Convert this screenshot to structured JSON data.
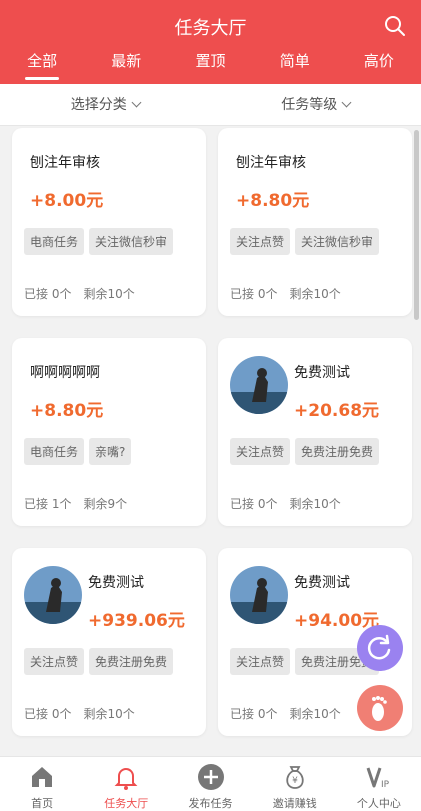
{
  "header": {
    "title": "任务大厅",
    "tabs": [
      "全部",
      "最新",
      "置顶",
      "简单",
      "高价"
    ]
  },
  "filters": {
    "category": "选择分类",
    "level": "任务等级"
  },
  "cards": [
    {
      "name": "刨注年审核",
      "price": "+8.00元",
      "tags": [
        "电商任务",
        "关注微信秒审"
      ],
      "taken": "已接 0个",
      "left": "剩余10个",
      "avatar": false
    },
    {
      "name": "刨注年审核",
      "price": "+8.80元",
      "tags": [
        "关注点赞",
        "关注微信秒审"
      ],
      "taken": "已接 0个",
      "left": "剩余10个",
      "avatar": false
    },
    {
      "name": "啊啊啊啊啊",
      "price": "+8.80元",
      "tags": [
        "电商任务",
        "亲嘴?"
      ],
      "taken": "已接 1个",
      "left": "剩余9个",
      "avatar": false
    },
    {
      "name": "免费测试",
      "price": "+20.68元",
      "tags": [
        "关注点赞",
        "免费注册免费"
      ],
      "taken": "已接 0个",
      "left": "剩余10个",
      "avatar": true
    },
    {
      "name": "免费测试",
      "price": "+939.06元",
      "tags": [
        "关注点赞",
        "免费注册免费"
      ],
      "taken": "已接 0个",
      "left": "剩余10个",
      "avatar": true
    },
    {
      "name": "免费测试",
      "price": "+94.00元",
      "tags": [
        "关注点赞",
        "免费注册免费"
      ],
      "taken": "已接 0个",
      "left": "剩余10个",
      "avatar": true
    }
  ],
  "bottom_nav": [
    {
      "label": "首页",
      "icon": "home-icon"
    },
    {
      "label": "任务大厅",
      "icon": "bell-icon"
    },
    {
      "label": "发布任务",
      "icon": "plus-icon"
    },
    {
      "label": "邀请赚钱",
      "icon": "money-bag-icon"
    },
    {
      "label": "个人中心",
      "icon": "vip-icon"
    }
  ],
  "colors": {
    "primary": "#ee4e4e",
    "price": "#f06a2f",
    "fab_refresh": "#9a82f0",
    "fab_foot": "#f07f74"
  }
}
